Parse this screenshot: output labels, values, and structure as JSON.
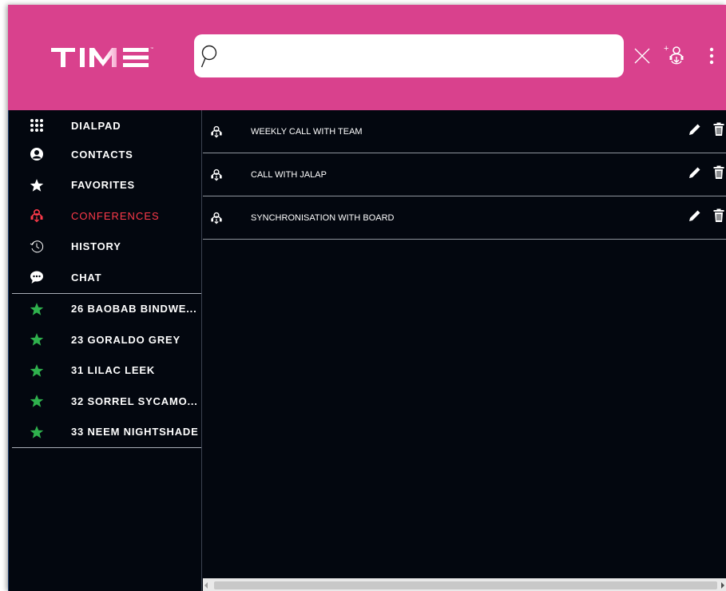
{
  "header": {
    "logo_text": "TIME",
    "brand_color": "#d9418d",
    "search": {
      "value": "",
      "placeholder": ""
    },
    "close_icon": "close-icon",
    "add_conference_icon": "add-conference-icon",
    "more_icon": "more-vertical-icon"
  },
  "sidebar": {
    "nav": [
      {
        "label": "DIALPAD",
        "icon": "dialpad-icon"
      },
      {
        "label": "CONTACTS",
        "icon": "contacts-icon"
      },
      {
        "label": "FAVORITES",
        "icon": "star-icon"
      },
      {
        "label": "CONFERENCES",
        "icon": "conference-icon",
        "active": true
      },
      {
        "label": "HISTORY",
        "icon": "history-icon"
      },
      {
        "label": "CHAT",
        "icon": "chat-icon"
      }
    ],
    "favorites": [
      {
        "label": "26 BAOBAB BINDWE..."
      },
      {
        "label": "23 GORALDO GREY"
      },
      {
        "label": "31 LILAC LEEK"
      },
      {
        "label": "32 SORREL SYCAMO..."
      },
      {
        "label": "33 NEEM NIGHTSHADE"
      }
    ],
    "active_color": "#ff3a4a",
    "favorite_star_color": "#2fb14d"
  },
  "main": {
    "conferences": [
      {
        "name": "WEEKLY CALL WITH TEAM"
      },
      {
        "name": "CALL WITH JALAP"
      },
      {
        "name": "SYNCHRONISATION WITH BOARD"
      }
    ]
  }
}
